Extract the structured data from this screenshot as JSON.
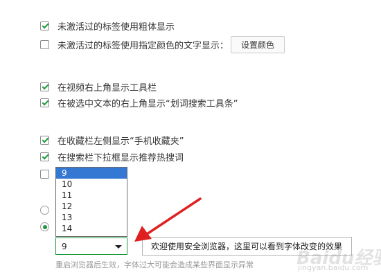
{
  "settings": {
    "unvisited_bold": {
      "label": "未激活过的标签使用粗体显示",
      "checked": true
    },
    "unvisited_color": {
      "label": "未激活过的标签使用指定颜色的文字显示：",
      "checked": false,
      "button": "设置颜色"
    },
    "video_toolbar": {
      "label": "在视频右上角显示工具栏",
      "checked": true
    },
    "selection_toolbar": {
      "label": "在被选中文本的右上角显示“划词搜索工具条”",
      "checked": true
    },
    "favorites_mobile": {
      "label": "在收藏栏左侧显示“手机收藏夹”",
      "checked": true
    },
    "search_hot": {
      "label": "在搜索栏下拉框显示推荐热搜词",
      "checked": true
    },
    "hidden_option": {
      "checked": false
    }
  },
  "radios": {
    "first_checked": false,
    "second_checked": true
  },
  "font_size": {
    "selected": "9",
    "options": [
      "9",
      "10",
      "11",
      "12",
      "13",
      "14"
    ]
  },
  "preview_text": "欢迎使用安全浏览器，这里可以看到字体改变的效果",
  "hint": "重启浏览器后生效，字体过大可能会造成某些界面显示异常",
  "annotation": {
    "color": "#e02020"
  },
  "watermark": {
    "text": "Baidu经验",
    "sub": "jingyan.baidu.com"
  }
}
